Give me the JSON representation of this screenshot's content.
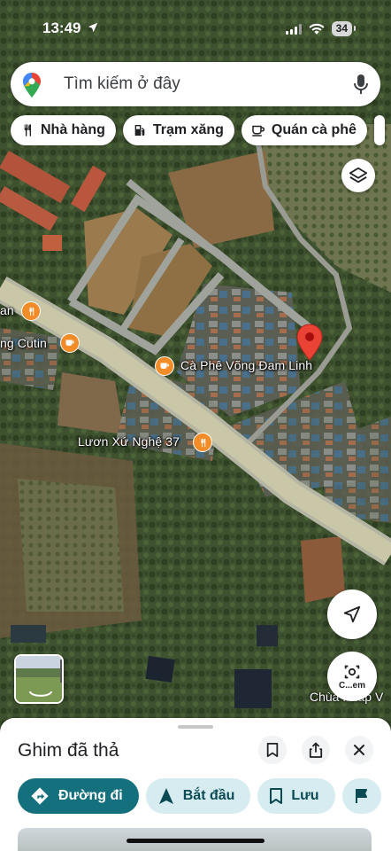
{
  "status_bar": {
    "time": "13:49",
    "battery": "34"
  },
  "search": {
    "placeholder": "Tìm kiếm ở đây"
  },
  "chips": [
    {
      "label": "Nhà hàng",
      "icon": "fork-knife-icon"
    },
    {
      "label": "Trạm xăng",
      "icon": "gas-station-icon"
    },
    {
      "label": "Quán cà phê",
      "icon": "coffee-cup-icon"
    }
  ],
  "map": {
    "labels": {
      "cafe_vong_dam_linh": "Cà Phê Võng Đam Linh",
      "luon_xu_nghe": "Lươn Xứ Nghệ 37",
      "cutin": "ng Cutin",
      "an": "an",
      "chua": "Chùa Pháp V"
    },
    "lens_label": "C...em"
  },
  "sheet": {
    "title": "Ghim đã thả",
    "actions": [
      {
        "label": "Đường đi",
        "icon": "directions-icon"
      },
      {
        "label": "Bắt đầu",
        "icon": "navigation-arrow-icon"
      },
      {
        "label": "Lưu",
        "icon": "bookmark-icon"
      },
      {
        "label": "",
        "icon": "flag-icon"
      }
    ]
  },
  "colors": {
    "primary_action": "#14707c",
    "secondary_action": "#d6ecf1",
    "pin_red": "#ea4335",
    "poi_orange": "#f28c28"
  }
}
